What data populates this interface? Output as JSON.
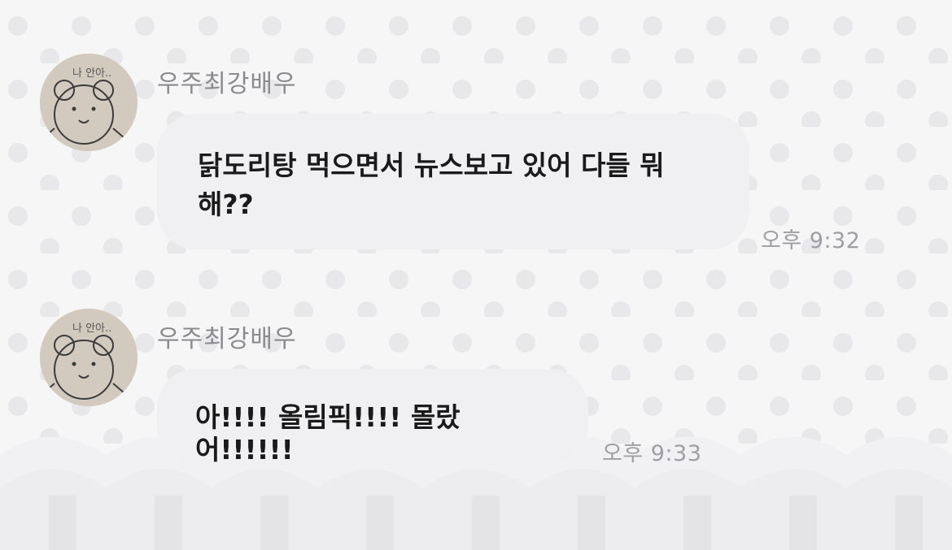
{
  "messages": [
    {
      "sender": "우주최강배우",
      "avatar_icon": "bear-drawing-avatar",
      "avatar_caption": "나 안아..",
      "text": " 닭도리탕 먹으면서 뉴스보고 있어 다들 뭐해??",
      "time": "오후 9:32"
    },
    {
      "sender": "우주최강배우",
      "avatar_icon": "bear-drawing-avatar",
      "avatar_caption": "나 안아..",
      "text": "아!!!! 올림픽!!!! 몰랐어!!!!!!",
      "time": "오후 9:33"
    }
  ],
  "colors": {
    "background": "#f6f6f7",
    "bubble": "#f0f0f3",
    "sender": "#8a8a8f",
    "time": "#9e9ea3",
    "dot": "#e6e6e9"
  }
}
